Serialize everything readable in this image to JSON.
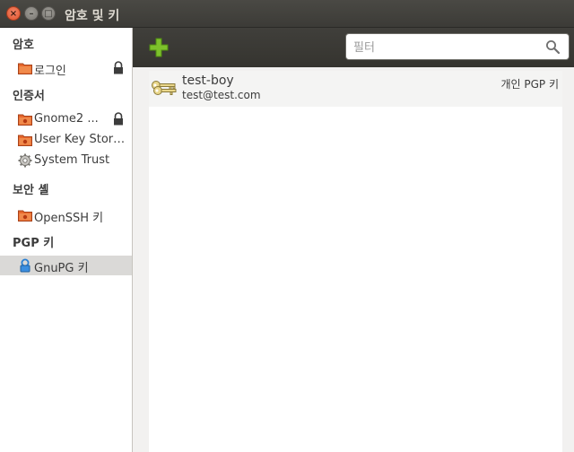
{
  "window": {
    "title": "암호 및 키",
    "close_glyph": "×",
    "minimize_glyph": "–",
    "maximize_glyph": "□"
  },
  "sidebar": {
    "sections": [
      {
        "label": "암호",
        "items": [
          {
            "label": "로그인",
            "icon": "folder-icon",
            "locked": true
          }
        ]
      },
      {
        "label": "인증서",
        "items": [
          {
            "label": "Gnome2 ...",
            "icon": "folder-icon",
            "locked": true
          },
          {
            "label": "User Key Stor…",
            "icon": "folder-icon",
            "locked": false
          },
          {
            "label": "System Trust",
            "icon": "gear-icon",
            "locked": false
          }
        ]
      },
      {
        "label": "보안 셸",
        "items": [
          {
            "label": "OpenSSH 키",
            "icon": "folder-icon",
            "locked": false
          }
        ]
      },
      {
        "label": "PGP 키",
        "items": [
          {
            "label": "GnuPG 키",
            "icon": "keyring-icon",
            "locked": false,
            "selected": true
          }
        ]
      }
    ]
  },
  "toolbar": {
    "add_icon": "plus-icon",
    "filter_placeholder": "필터",
    "search_icon": "search-icon"
  },
  "keys": [
    {
      "name": "test-boy",
      "email": "test@test.com",
      "type": "개인 PGP 키",
      "icon": "key-pair-icon"
    }
  ],
  "colors": {
    "titlebar": "#3c3b37",
    "toolbar": "#3a3935",
    "add_green": "#7dc12b",
    "folder_orange": "#e8672b",
    "selection": "#dad9d7"
  }
}
